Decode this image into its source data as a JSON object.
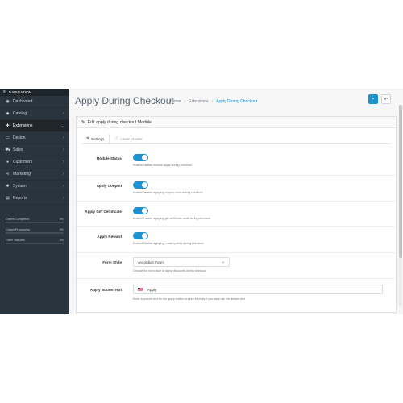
{
  "sidebar": {
    "header": "NAVIGATION",
    "items": [
      {
        "label": "Dashboard",
        "icon": "dashboard-icon",
        "glyph": "◉"
      },
      {
        "label": "Catalog",
        "icon": "tag-icon",
        "glyph": "◆"
      },
      {
        "label": "Extensions",
        "icon": "puzzle-icon",
        "glyph": "✚"
      },
      {
        "label": "Design",
        "icon": "monitor-icon",
        "glyph": "▭"
      },
      {
        "label": "Sales",
        "icon": "cart-icon",
        "glyph": "⛟"
      },
      {
        "label": "Customers",
        "icon": "user-icon",
        "glyph": "●"
      },
      {
        "label": "Marketing",
        "icon": "share-icon",
        "glyph": "⋖"
      },
      {
        "label": "System",
        "icon": "gear-icon",
        "glyph": "✱"
      },
      {
        "label": "Reports",
        "icon": "bar-chart-icon",
        "glyph": "▤"
      }
    ],
    "progress": [
      {
        "label": "Orders Completed",
        "value": "0%",
        "fraction": 0
      },
      {
        "label": "Orders Processing",
        "value": "0%",
        "fraction": 0
      },
      {
        "label": "Other Statuses",
        "value": "0%",
        "fraction": 0
      }
    ]
  },
  "header": {
    "title": "Apply During Checkout",
    "breadcrumb": {
      "home": "Home",
      "extensions": "Extensions",
      "current": "Apply During Checkout"
    }
  },
  "panel": {
    "title": "Edit apply during checkout Module",
    "tabs": {
      "settings": "Settings",
      "about": "About Module"
    }
  },
  "form": {
    "module_status": {
      "label": "Module Status",
      "help": "Enable/Disable module apply during checkout",
      "enabled": true
    },
    "apply_coupon": {
      "label": "Apply Coupon",
      "help": "Enable/Disable applying coupon code during checkout",
      "enabled": true
    },
    "apply_gift": {
      "label": "Apply Gift Certificate",
      "help": "Enable/Disable applying gift certificate code during checkout",
      "enabled": true
    },
    "apply_reward": {
      "label": "Apply Reward",
      "help": "Enable/Disable applying reward points during checkout",
      "enabled": true
    },
    "form_style": {
      "label": "Form Style",
      "value": "Accordion Form",
      "help": "Choose the form style to apply discounts during checkout"
    },
    "button_text": {
      "label": "Apply Button Text",
      "value": "Apply",
      "help": "Enter a custom text for the apply button or keep it empty if you want use the default text"
    }
  },
  "colors": {
    "accent": "#1e91cf",
    "sidebar": "#2a343c"
  }
}
